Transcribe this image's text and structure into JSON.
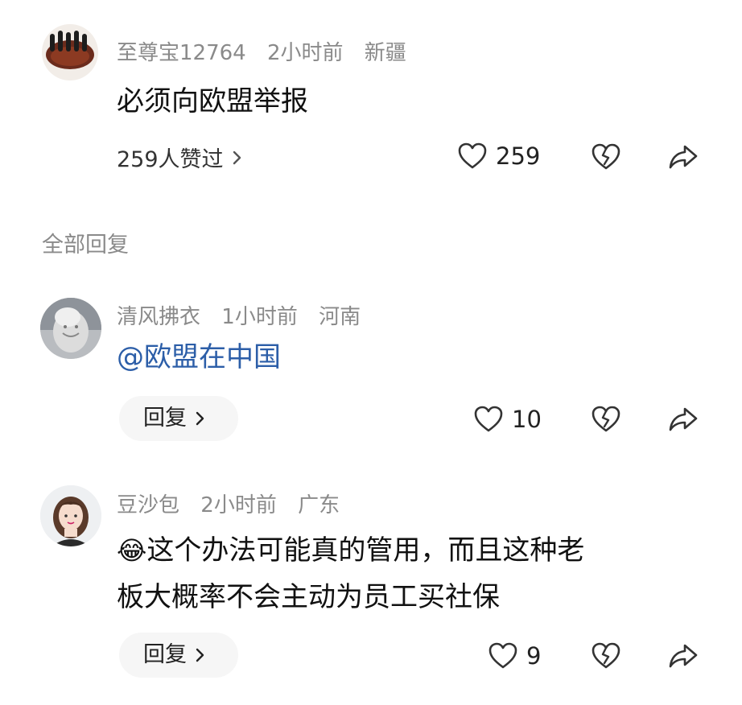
{
  "main_comment": {
    "username": "至尊宝12764",
    "time": "2小时前",
    "location": "新疆",
    "content": "必须向欧盟举报",
    "likes_summary": "259人赞过",
    "like_count": "259",
    "avatar_icon": "hands-photo-avatar"
  },
  "replies_section": {
    "title": "全部回复"
  },
  "replies": [
    {
      "username": "清风拂衣",
      "time": "1小时前",
      "location": "河南",
      "content": "@欧盟在中国",
      "like_count": "10",
      "reply_label": "回复",
      "avatar_icon": "statue-avatar"
    },
    {
      "username": "豆沙包",
      "time": "2小时前",
      "location": "广东",
      "content_line1": "这个办法可能真的管用，而且这种老",
      "content_line2": "板大概率不会主动为员工买社保",
      "emoji": "😂",
      "like_count": "9",
      "reply_label": "回复",
      "avatar_icon": "cartoon-girl-avatar"
    }
  ],
  "colors": {
    "meta_gray": "#8a8a8a",
    "mention_blue": "#2c5ea8",
    "pill_bg": "#f6f6f6"
  }
}
